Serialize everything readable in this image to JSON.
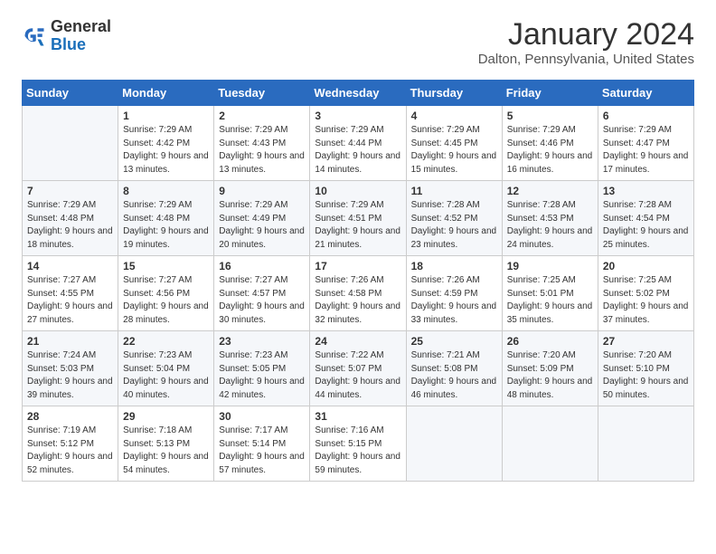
{
  "header": {
    "logo_general": "General",
    "logo_blue": "Blue",
    "month_title": "January 2024",
    "location": "Dalton, Pennsylvania, United States"
  },
  "days_of_week": [
    "Sunday",
    "Monday",
    "Tuesday",
    "Wednesday",
    "Thursday",
    "Friday",
    "Saturday"
  ],
  "weeks": [
    [
      {
        "day": "",
        "sunrise": "",
        "sunset": "",
        "daylight": ""
      },
      {
        "day": "1",
        "sunrise": "Sunrise: 7:29 AM",
        "sunset": "Sunset: 4:42 PM",
        "daylight": "Daylight: 9 hours and 13 minutes."
      },
      {
        "day": "2",
        "sunrise": "Sunrise: 7:29 AM",
        "sunset": "Sunset: 4:43 PM",
        "daylight": "Daylight: 9 hours and 13 minutes."
      },
      {
        "day": "3",
        "sunrise": "Sunrise: 7:29 AM",
        "sunset": "Sunset: 4:44 PM",
        "daylight": "Daylight: 9 hours and 14 minutes."
      },
      {
        "day": "4",
        "sunrise": "Sunrise: 7:29 AM",
        "sunset": "Sunset: 4:45 PM",
        "daylight": "Daylight: 9 hours and 15 minutes."
      },
      {
        "day": "5",
        "sunrise": "Sunrise: 7:29 AM",
        "sunset": "Sunset: 4:46 PM",
        "daylight": "Daylight: 9 hours and 16 minutes."
      },
      {
        "day": "6",
        "sunrise": "Sunrise: 7:29 AM",
        "sunset": "Sunset: 4:47 PM",
        "daylight": "Daylight: 9 hours and 17 minutes."
      }
    ],
    [
      {
        "day": "7",
        "sunrise": "Sunrise: 7:29 AM",
        "sunset": "Sunset: 4:48 PM",
        "daylight": "Daylight: 9 hours and 18 minutes."
      },
      {
        "day": "8",
        "sunrise": "Sunrise: 7:29 AM",
        "sunset": "Sunset: 4:48 PM",
        "daylight": "Daylight: 9 hours and 19 minutes."
      },
      {
        "day": "9",
        "sunrise": "Sunrise: 7:29 AM",
        "sunset": "Sunset: 4:49 PM",
        "daylight": "Daylight: 9 hours and 20 minutes."
      },
      {
        "day": "10",
        "sunrise": "Sunrise: 7:29 AM",
        "sunset": "Sunset: 4:51 PM",
        "daylight": "Daylight: 9 hours and 21 minutes."
      },
      {
        "day": "11",
        "sunrise": "Sunrise: 7:28 AM",
        "sunset": "Sunset: 4:52 PM",
        "daylight": "Daylight: 9 hours and 23 minutes."
      },
      {
        "day": "12",
        "sunrise": "Sunrise: 7:28 AM",
        "sunset": "Sunset: 4:53 PM",
        "daylight": "Daylight: 9 hours and 24 minutes."
      },
      {
        "day": "13",
        "sunrise": "Sunrise: 7:28 AM",
        "sunset": "Sunset: 4:54 PM",
        "daylight": "Daylight: 9 hours and 25 minutes."
      }
    ],
    [
      {
        "day": "14",
        "sunrise": "Sunrise: 7:27 AM",
        "sunset": "Sunset: 4:55 PM",
        "daylight": "Daylight: 9 hours and 27 minutes."
      },
      {
        "day": "15",
        "sunrise": "Sunrise: 7:27 AM",
        "sunset": "Sunset: 4:56 PM",
        "daylight": "Daylight: 9 hours and 28 minutes."
      },
      {
        "day": "16",
        "sunrise": "Sunrise: 7:27 AM",
        "sunset": "Sunset: 4:57 PM",
        "daylight": "Daylight: 9 hours and 30 minutes."
      },
      {
        "day": "17",
        "sunrise": "Sunrise: 7:26 AM",
        "sunset": "Sunset: 4:58 PM",
        "daylight": "Daylight: 9 hours and 32 minutes."
      },
      {
        "day": "18",
        "sunrise": "Sunrise: 7:26 AM",
        "sunset": "Sunset: 4:59 PM",
        "daylight": "Daylight: 9 hours and 33 minutes."
      },
      {
        "day": "19",
        "sunrise": "Sunrise: 7:25 AM",
        "sunset": "Sunset: 5:01 PM",
        "daylight": "Daylight: 9 hours and 35 minutes."
      },
      {
        "day": "20",
        "sunrise": "Sunrise: 7:25 AM",
        "sunset": "Sunset: 5:02 PM",
        "daylight": "Daylight: 9 hours and 37 minutes."
      }
    ],
    [
      {
        "day": "21",
        "sunrise": "Sunrise: 7:24 AM",
        "sunset": "Sunset: 5:03 PM",
        "daylight": "Daylight: 9 hours and 39 minutes."
      },
      {
        "day": "22",
        "sunrise": "Sunrise: 7:23 AM",
        "sunset": "Sunset: 5:04 PM",
        "daylight": "Daylight: 9 hours and 40 minutes."
      },
      {
        "day": "23",
        "sunrise": "Sunrise: 7:23 AM",
        "sunset": "Sunset: 5:05 PM",
        "daylight": "Daylight: 9 hours and 42 minutes."
      },
      {
        "day": "24",
        "sunrise": "Sunrise: 7:22 AM",
        "sunset": "Sunset: 5:07 PM",
        "daylight": "Daylight: 9 hours and 44 minutes."
      },
      {
        "day": "25",
        "sunrise": "Sunrise: 7:21 AM",
        "sunset": "Sunset: 5:08 PM",
        "daylight": "Daylight: 9 hours and 46 minutes."
      },
      {
        "day": "26",
        "sunrise": "Sunrise: 7:20 AM",
        "sunset": "Sunset: 5:09 PM",
        "daylight": "Daylight: 9 hours and 48 minutes."
      },
      {
        "day": "27",
        "sunrise": "Sunrise: 7:20 AM",
        "sunset": "Sunset: 5:10 PM",
        "daylight": "Daylight: 9 hours and 50 minutes."
      }
    ],
    [
      {
        "day": "28",
        "sunrise": "Sunrise: 7:19 AM",
        "sunset": "Sunset: 5:12 PM",
        "daylight": "Daylight: 9 hours and 52 minutes."
      },
      {
        "day": "29",
        "sunrise": "Sunrise: 7:18 AM",
        "sunset": "Sunset: 5:13 PM",
        "daylight": "Daylight: 9 hours and 54 minutes."
      },
      {
        "day": "30",
        "sunrise": "Sunrise: 7:17 AM",
        "sunset": "Sunset: 5:14 PM",
        "daylight": "Daylight: 9 hours and 57 minutes."
      },
      {
        "day": "31",
        "sunrise": "Sunrise: 7:16 AM",
        "sunset": "Sunset: 5:15 PM",
        "daylight": "Daylight: 9 hours and 59 minutes."
      },
      {
        "day": "",
        "sunrise": "",
        "sunset": "",
        "daylight": ""
      },
      {
        "day": "",
        "sunrise": "",
        "sunset": "",
        "daylight": ""
      },
      {
        "day": "",
        "sunrise": "",
        "sunset": "",
        "daylight": ""
      }
    ]
  ]
}
